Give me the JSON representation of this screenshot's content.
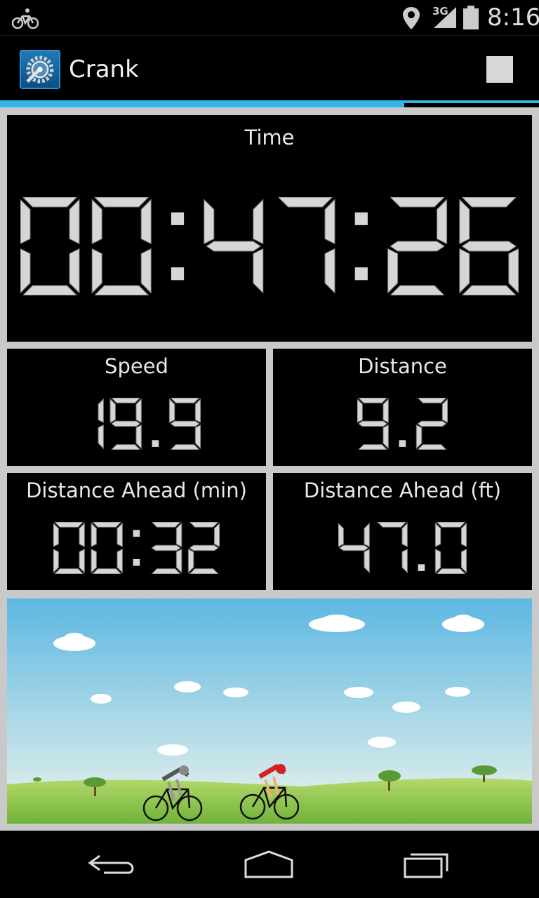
{
  "status_bar": {
    "notification_icon": "bicycle-icon",
    "location_icon": "location-pin-icon",
    "network_type": "3G",
    "signal_icon": "signal-icon",
    "battery_icon": "battery-icon",
    "clock": "8:16"
  },
  "action_bar": {
    "app_icon": "crank-gear-icon",
    "title": "Crank",
    "stop_icon": "stop-icon"
  },
  "progress": {
    "value": 0.75
  },
  "time_panel": {
    "label": "Time",
    "value": "00:47:26"
  },
  "speed_panel": {
    "label": "Speed",
    "value": "19.9"
  },
  "distance_panel": {
    "label": "Distance",
    "value": "9.2"
  },
  "ahead_min_panel": {
    "label": "Distance Ahead (min)",
    "value": "00:32"
  },
  "ahead_ft_panel": {
    "label": "Distance Ahead (ft)",
    "value": "47.0"
  },
  "scene": {
    "icons": [
      "cloud-icon",
      "tree-icon",
      "cyclist-ghost-icon",
      "cyclist-red-icon"
    ],
    "colors": {
      "sky_top": "#5db7e2",
      "sky_bottom": "#eef5ec",
      "grass": "#8cc63e",
      "rider_red": "#d42323"
    }
  },
  "nav_bar": {
    "back_icon": "back-icon",
    "home_icon": "home-icon",
    "recents_icon": "recents-icon"
  },
  "colors": {
    "accent": "#33b5e5",
    "lcd": "#d6d6d6",
    "panel_bg": "#000000",
    "frame": "#c9c9c9"
  }
}
